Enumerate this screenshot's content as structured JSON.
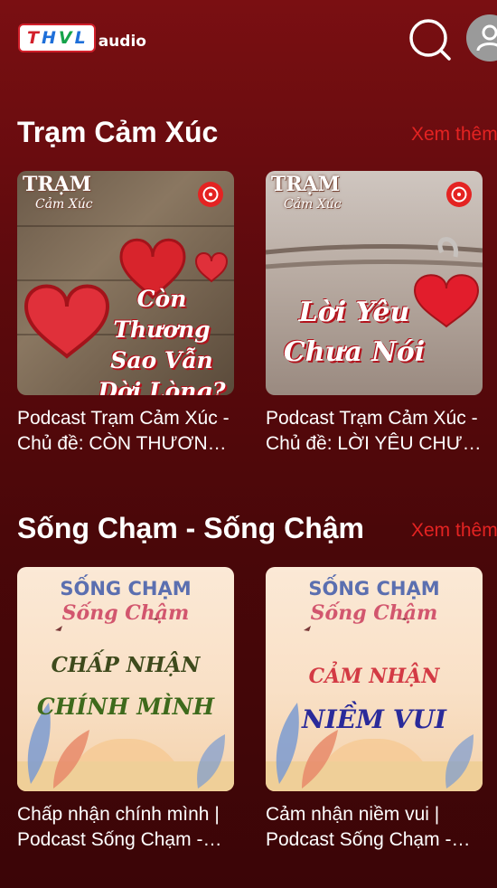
{
  "app": {
    "logo_letters": [
      "T",
      "H",
      "V",
      "L"
    ],
    "logo_sub": "audio",
    "icons": {
      "search": "search-icon",
      "account": "user-icon",
      "disc": "disc-icon"
    },
    "colors": {
      "background": "#5e0a0d",
      "accent": "#e42322"
    }
  },
  "sections": [
    {
      "title": "Trạm Cảm Xúc",
      "see_more": "Xem thêm",
      "cards": [
        {
          "title": "Podcast Trạm Cảm Xúc - Chủ đề: CÒN THƯƠNG SAO VẪN DỜI LÒNG?",
          "cover_logo": "TRẠM",
          "cover_logo_sub": "Cảm Xúc",
          "cover_lines": [
            "Còn Thương",
            "Sao Vẫn",
            "Dời Lòng?"
          ]
        },
        {
          "title": "Podcast Trạm Cảm Xúc - Chủ đề: LỜI YÊU CHƯA NÓI",
          "cover_logo": "TRẠM",
          "cover_logo_sub": "Cảm Xúc",
          "cover_lines": [
            "Lời Yêu",
            "Chưa Nói"
          ]
        }
      ]
    },
    {
      "title": "Sống Chạm - Sống Chậm",
      "see_more": "Xem thêm",
      "cards": [
        {
          "title": "Chấp nhận chính mình | Podcast Sống Chạm - Sống Chậm",
          "cover_title": "SỐNG CHẠM",
          "cover_sub": "Sống Chậm",
          "cover_lines": [
            "CHẤP NHẬN",
            "CHÍNH MÌNH"
          ]
        },
        {
          "title": "Cảm nhận niềm vui | Podcast Sống Chạm - Sống Chậm",
          "cover_title": "SỐNG CHẠM",
          "cover_sub": "Sống Chậm",
          "cover_lines": [
            "CẢM NHẬN",
            "NIỀM VUI"
          ]
        }
      ]
    }
  ]
}
